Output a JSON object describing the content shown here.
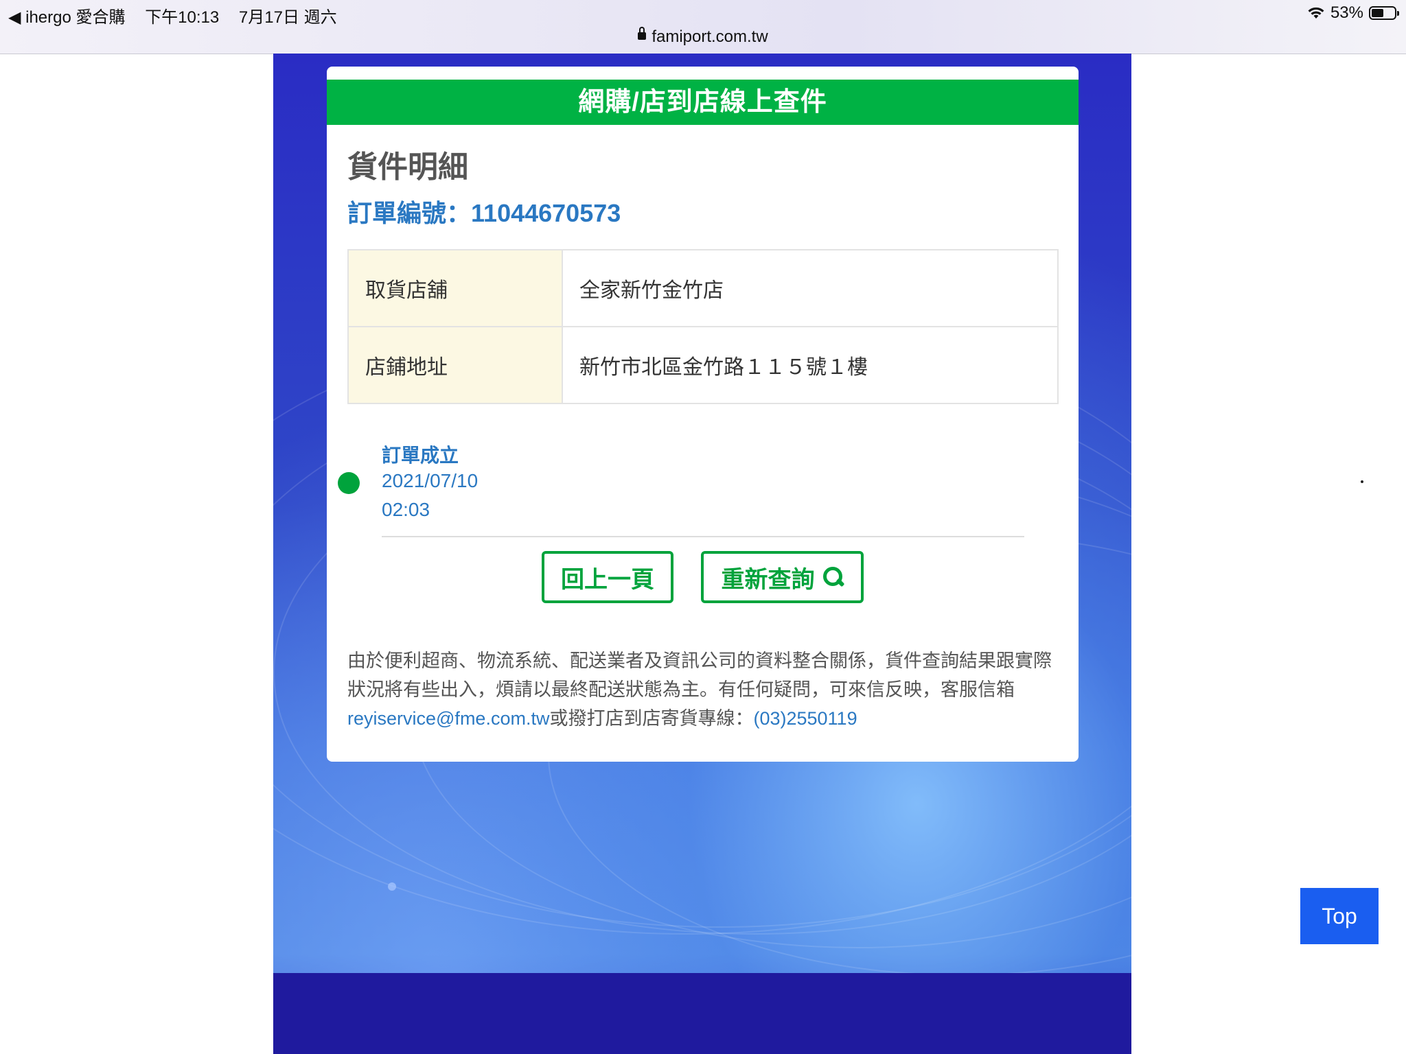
{
  "status_bar": {
    "back_app": "◀ ihergo 愛合購",
    "time": "下午10:13",
    "date": "7月17日 週六",
    "battery": "53%",
    "battery_level": 0.53,
    "url": "famiport.com.tw"
  },
  "card": {
    "header": "網購/店到店線上查件",
    "detail_title": "貨件明細",
    "order_label": "訂單編號：",
    "order_number": "11044670573",
    "rows": [
      {
        "key": "取貨店舖",
        "value": "全家新竹金竹店"
      },
      {
        "key": "店鋪地址",
        "value": "新竹市北區金竹路１１５號１樓"
      }
    ],
    "timeline": {
      "status": "訂單成立",
      "date": "2021/07/10",
      "time": "02:03"
    },
    "buttons": {
      "back": "回上一頁",
      "requery": "重新查詢"
    },
    "note": {
      "text": "由於便利超商、物流系統、配送業者及資訊公司的資料整合關係，貨件查詢結果跟實際狀況將有些出入，煩請以最終配送狀態為主。有任何疑問，可來信反映，客服信箱",
      "email": "reyiservice@fme.com.tw",
      "mid": "或撥打店到店寄貨專線：",
      "phone": "(03)2550119"
    }
  },
  "top_button": "Top",
  "colors": {
    "header_green": "#00b244",
    "link_blue": "#2a78c2",
    "top_button_blue": "#1a5ef0"
  }
}
